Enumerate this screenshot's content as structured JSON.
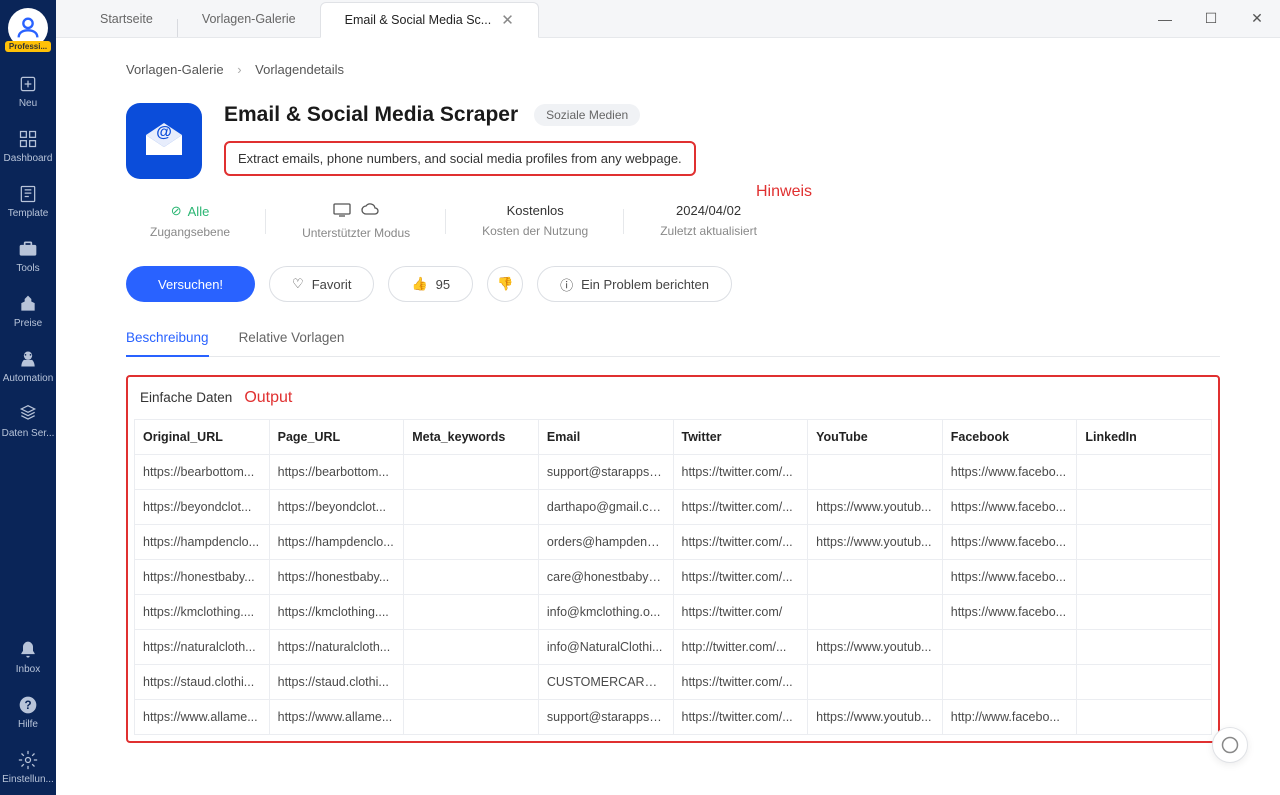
{
  "sidebar": {
    "badge": "Professi...",
    "items": [
      {
        "label": "Neu"
      },
      {
        "label": "Dashboard"
      },
      {
        "label": "Template"
      },
      {
        "label": "Tools"
      },
      {
        "label": "Preise"
      },
      {
        "label": "Automation"
      },
      {
        "label": "Daten Ser..."
      }
    ],
    "bottom": [
      {
        "label": "Inbox"
      },
      {
        "label": "Hilfe"
      },
      {
        "label": "Einstellun..."
      }
    ]
  },
  "topTabs": {
    "home": "Startseite",
    "gallery": "Vorlagen-Galerie",
    "active": "Email & Social Media Sc..."
  },
  "breadcrumb": {
    "gallery": "Vorlagen-Galerie",
    "details": "Vorlagendetails"
  },
  "page": {
    "title": "Email & Social Media Scraper",
    "category": "Soziale Medien",
    "description": "Extract emails, phone numbers, and social media profiles from any webpage.",
    "hinweis": "Hinweis"
  },
  "meta": {
    "access": {
      "top": "Alle",
      "bottom": "Zugangsebene"
    },
    "mode": {
      "bottom": "Unterstützter Modus"
    },
    "cost": {
      "top": "Kostenlos",
      "bottom": "Kosten der Nutzung"
    },
    "updated": {
      "top": "2024/04/02",
      "bottom": "Zuletzt aktualisiert"
    }
  },
  "actions": {
    "try": "Versuchen!",
    "favorite": "Favorit",
    "likes": "95",
    "report": "Ein Problem berichten"
  },
  "innerTabs": {
    "desc": "Beschreibung",
    "related": "Relative Vorlagen"
  },
  "output": {
    "title": "Einfache Daten",
    "label": "Output"
  },
  "table": {
    "headers": [
      "Original_URL",
      "Page_URL",
      "Meta_keywords",
      "Email",
      "Twitter",
      "YouTube",
      "Facebook",
      "LinkedIn"
    ],
    "rows": [
      [
        "https://bearbottom...",
        "https://bearbottom...",
        "",
        "support@starapps.s...",
        "https://twitter.com/...",
        "",
        "https://www.facebo...",
        ""
      ],
      [
        "https://beyondclot...",
        "https://beyondclot...",
        "",
        "darthapo@gmail.co...",
        "https://twitter.com/...",
        "https://www.youtub...",
        "https://www.facebo...",
        ""
      ],
      [
        "https://hampdenclo...",
        "https://hampdenclo...",
        "",
        "orders@hampdencl...",
        "https://twitter.com/...",
        "https://www.youtub...",
        "https://www.facebo...",
        ""
      ],
      [
        "https://honestbaby...",
        "https://honestbaby...",
        "",
        "care@honestbabycl...",
        "https://twitter.com/...",
        "",
        "https://www.facebo...",
        ""
      ],
      [
        "https://kmclothing....",
        "https://kmclothing....",
        "",
        "info@kmclothing.o...",
        "https://twitter.com/",
        "",
        "https://www.facebo...",
        ""
      ],
      [
        "https://naturalcloth...",
        "https://naturalcloth...",
        "",
        "info@NaturalClothi...",
        "http://twitter.com/...",
        "https://www.youtub...",
        "",
        ""
      ],
      [
        "https://staud.clothi...",
        "https://staud.clothi...",
        "",
        "CUSTOMERCARE@...",
        "https://twitter.com/...",
        "",
        "",
        ""
      ],
      [
        "https://www.allame...",
        "https://www.allame...",
        "",
        "support@starapps.s...",
        "https://twitter.com/...",
        "https://www.youtub...",
        "http://www.facebo...",
        ""
      ]
    ]
  }
}
